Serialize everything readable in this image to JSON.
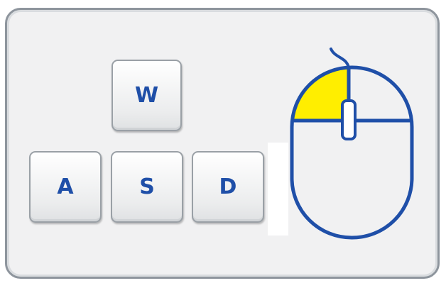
{
  "keys": {
    "w": "W",
    "a": "A",
    "s": "S",
    "d": "D"
  },
  "mouse": {
    "highlighted_button": "left",
    "outline_color": "#1f4fa8",
    "highlight_color": "#ffee00"
  },
  "colors": {
    "key_text": "#1f4fa8",
    "panel_background": "#f1f1f2",
    "panel_border": "#8e959d"
  }
}
